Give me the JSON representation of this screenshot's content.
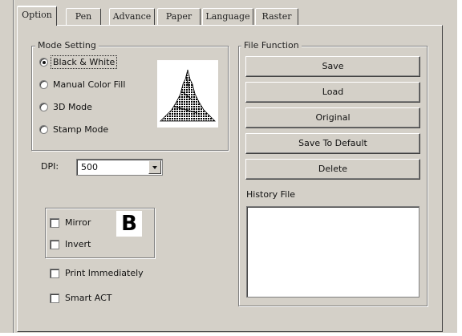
{
  "tabs": [
    {
      "label": "Option",
      "active": true
    },
    {
      "label": "Pen",
      "active": false
    },
    {
      "label": "Advance",
      "active": false
    },
    {
      "label": "Paper",
      "active": false
    },
    {
      "label": "Language",
      "active": false
    },
    {
      "label": "Raster",
      "active": false
    }
  ],
  "mode_setting": {
    "title": "Mode Setting",
    "options": [
      {
        "label": "Black & White",
        "selected": true
      },
      {
        "label": "Manual Color Fill",
        "selected": false
      },
      {
        "label": "3D Mode",
        "selected": false
      },
      {
        "label": "Stamp Mode",
        "selected": false
      }
    ],
    "preview_icon": "halftone-mountain-icon"
  },
  "dpi": {
    "label": "DPI:",
    "value": "500"
  },
  "options_box": {
    "mirror": {
      "label": "Mirror",
      "checked": false
    },
    "invert": {
      "label": "Invert",
      "checked": false
    },
    "preview_letter": "B"
  },
  "print_immediately": {
    "label": "Print Immediately",
    "checked": false
  },
  "smart_act": {
    "label": "Smart ACT",
    "checked": false
  },
  "file_function": {
    "title": "File Function",
    "buttons": [
      "Save",
      "Load",
      "Original",
      "Save To Default",
      "Delete"
    ],
    "history_label": "History File"
  },
  "colors": {
    "face": "#d4d0c8",
    "shadow": "#808080",
    "highlight": "#ffffff"
  }
}
